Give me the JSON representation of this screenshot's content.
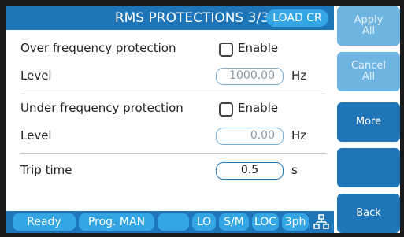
{
  "header": {
    "title": "RMS PROTECTIONS 3/3",
    "mode_badge": "LOAD CR"
  },
  "form": {
    "over_freq": {
      "label": "Over frequency protection",
      "enable_label": "Enable",
      "enabled": false,
      "level_label": "Level",
      "level_value": "1000.00",
      "unit": "Hz"
    },
    "under_freq": {
      "label": "Under frequency protection",
      "enable_label": "Enable",
      "enabled": false,
      "level_label": "Level",
      "level_value": "0.00",
      "unit": "Hz"
    },
    "trip_time": {
      "label": "Trip time",
      "value": "0.5",
      "unit": "s"
    }
  },
  "sidebar": {
    "apply_all": "Apply\nAll",
    "cancel_all": "Cancel\nAll",
    "more": "More",
    "blank": "",
    "back": "Back"
  },
  "status_bar": {
    "ready": "Ready",
    "program": "Prog. MAN",
    "empty": "",
    "lo": "LO",
    "sm": "S/M",
    "loc": "LOC",
    "phase": "3ph",
    "network_icon": "network-icon"
  },
  "colors": {
    "primary": "#1e75b8",
    "accent": "#34a6e4",
    "disabled": "#6eb4e0"
  }
}
